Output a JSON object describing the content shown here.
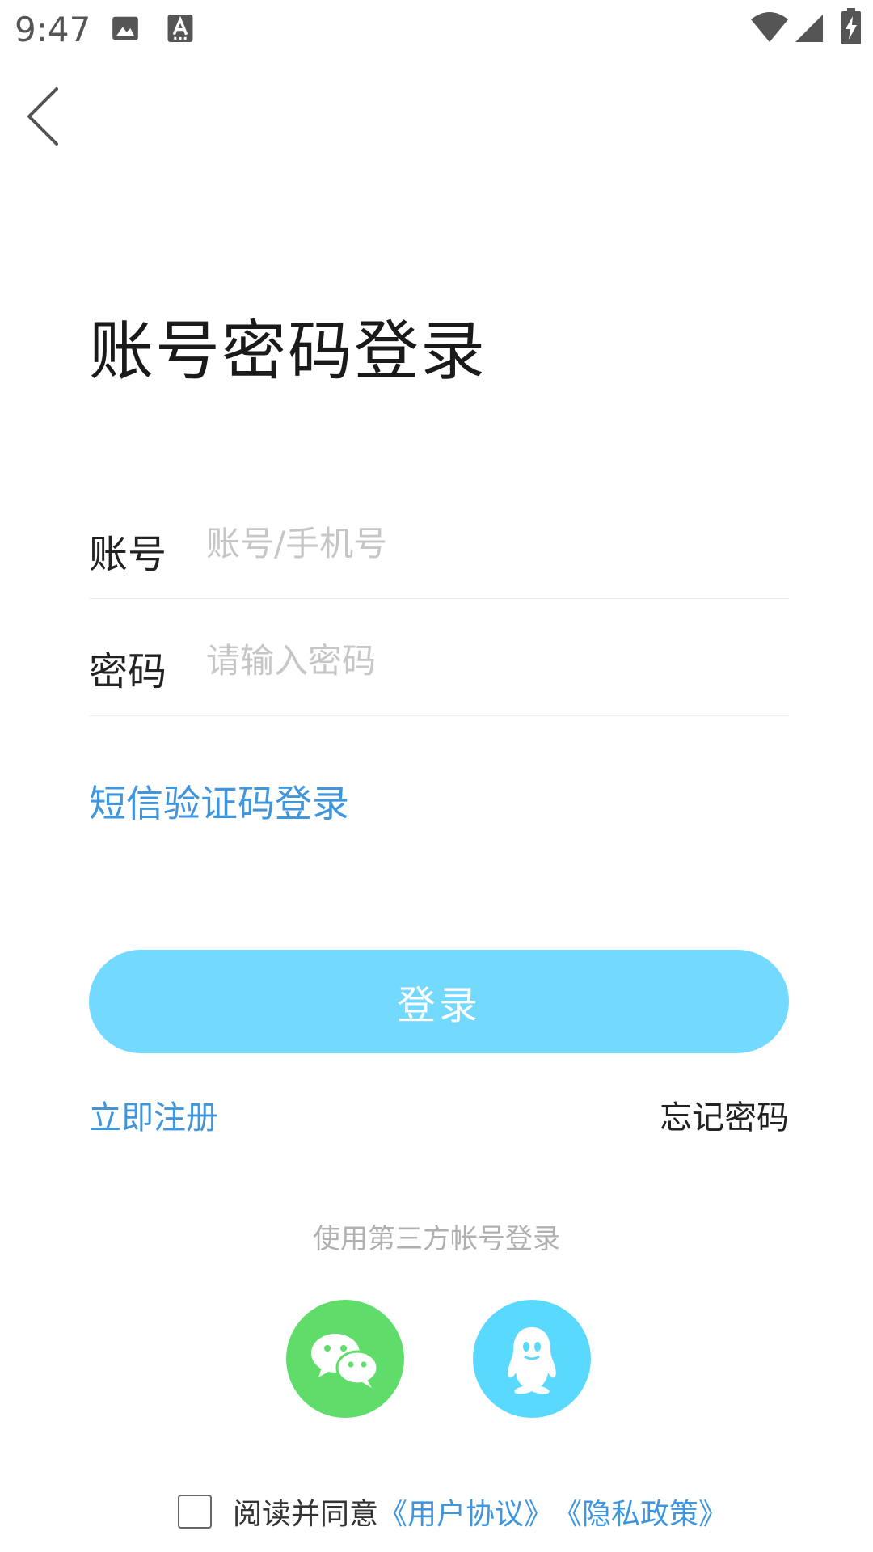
{
  "status_bar": {
    "time": "9:47"
  },
  "login": {
    "title": "账号密码登录",
    "account_label": "账号",
    "account_placeholder": "账号/手机号",
    "password_label": "密码",
    "password_placeholder": "请输入密码",
    "sms_login": "短信验证码登录",
    "submit_label": "登录",
    "register": "立即注册",
    "forgot_password": "忘记密码",
    "third_party_title": "使用第三方帐号登录"
  },
  "agreement": {
    "prefix": "阅读并同意",
    "user_agreement": "《用户协议》",
    "privacy_policy": "《隐私政策》"
  },
  "colors": {
    "accent_blue": "#3f96dc",
    "login_button": "#74d9ff",
    "wechat_green": "#5fdc6a",
    "qq_blue": "#5ad9ff"
  },
  "icons": {
    "back": "chevron-left-icon",
    "wechat": "wechat-icon",
    "qq": "qq-penguin-icon"
  }
}
